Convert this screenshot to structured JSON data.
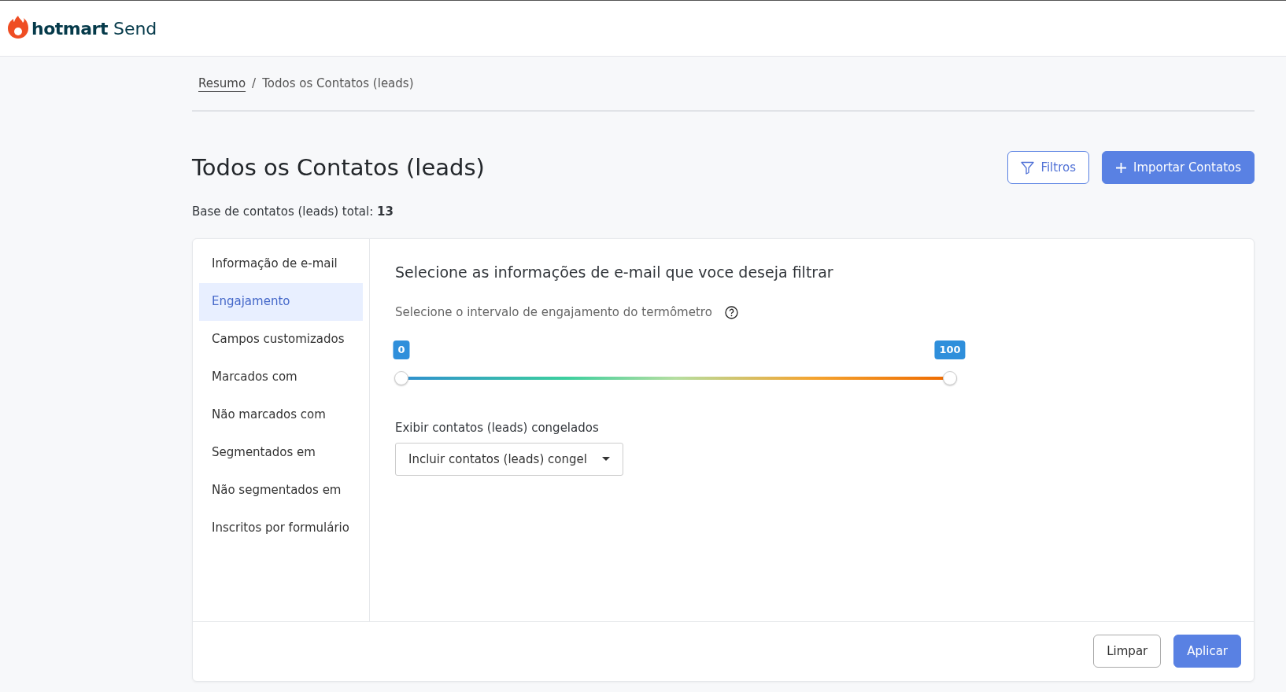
{
  "header": {
    "logo_word": "hotmart",
    "logo_product": "Send"
  },
  "breadcrumb": [
    {
      "label": "Resumo",
      "kind": "link"
    },
    {
      "label": "/",
      "kind": "separator"
    },
    {
      "label": "Todos os Contatos (leads)",
      "kind": "current"
    }
  ],
  "page": {
    "title": "Todos os Contatos (leads)",
    "total_label": "Base de contatos (leads) total: ",
    "total_value": "13"
  },
  "actions": [
    {
      "label": "Filtros",
      "kind": "outline"
    },
    {
      "label": "Importar Contatos",
      "kind": "primary"
    }
  ],
  "filter_menu": [
    {
      "label": "Informação de e-mail",
      "selected": false
    },
    {
      "label": "Engajamento",
      "selected": true
    },
    {
      "label": "Campos customizados",
      "selected": false
    },
    {
      "label": "Marcados com",
      "selected": false
    },
    {
      "label": "Não marcados com",
      "selected": false
    },
    {
      "label": "Segmentados em",
      "selected": false
    },
    {
      "label": "Não segmentados em",
      "selected": false
    },
    {
      "label": "Inscritos por formulário",
      "selected": false
    }
  ],
  "panel": {
    "heading": "Selecione as informações de e-mail que voce deseja filtrar",
    "range_label": "Selecione o intervalo de engajamento do termômetro",
    "range": {
      "low": {
        "level": 0,
        "label": "0"
      },
      "high": {
        "level": 1,
        "label": "100"
      }
    },
    "frozen_label": "Exibir contatos (leads) congelados",
    "frozen_select": "Incluir contatos (leads) congel"
  },
  "footer_buttons": [
    {
      "label": "Limpar",
      "kind": "plain"
    },
    {
      "label": "Aplicar",
      "kind": "primary"
    }
  ]
}
